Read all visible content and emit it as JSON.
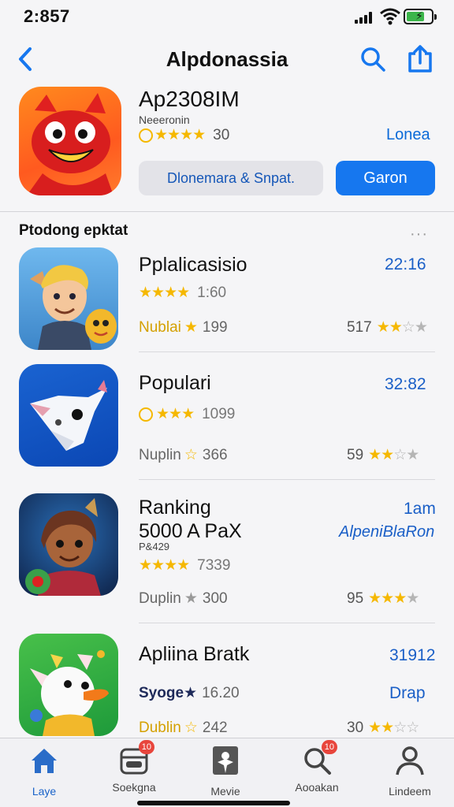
{
  "status": {
    "time": "2:857"
  },
  "nav": {
    "title": "Alpdonassia"
  },
  "featured": {
    "title": "Ap2308IM",
    "subtitle": "Neeeronin",
    "stars": "★★★★",
    "rating": "30",
    "link": "Lonea",
    "secondary_button": "Dlonemara & Snpat.",
    "primary_button": "Garon"
  },
  "section": {
    "title": "Ptodong epktat",
    "more": "···"
  },
  "apps": [
    {
      "name": "Pplalicasisio",
      "time": "22:16",
      "stars": "★★★★",
      "rating": "1:60",
      "meta_label": "Nublai",
      "meta_star": "★",
      "meta_value": "199",
      "side_value": "517",
      "side_stars_on": "★★",
      "side_stars_off": "☆★"
    },
    {
      "name": "Populari",
      "time": "32:82",
      "stars": "★★★",
      "rating": "1099",
      "meta_label": "Nuplin",
      "meta_star": "☆",
      "meta_value": "366",
      "side_value": "59",
      "side_stars_on": "★★",
      "side_stars_off": "☆★"
    },
    {
      "name": "Ranking",
      "extra": "5000 A PaX",
      "extra2": "P&429",
      "time": "1am",
      "link": "AlpeniBlaRon",
      "stars": "★★★★",
      "rating": "7339",
      "meta_label": "Duplin",
      "meta_star": "★",
      "meta_value": "300",
      "side_value": "95",
      "side_stars_on": "★★★",
      "side_stars_off": "★"
    },
    {
      "name": "Apliina Bratk",
      "time": "31912",
      "meta_top_label": "Syoge",
      "meta_top_star": "★",
      "meta_top_value": "16.20",
      "link": "Drap",
      "meta_label": "Dublin",
      "meta_star": "☆",
      "meta_value": "242",
      "side_value": "30",
      "side_stars_on": "★★",
      "side_stars_off": "☆☆"
    }
  ],
  "tabs": [
    {
      "label": "Laye",
      "active": true
    },
    {
      "label": "Soekgna",
      "badge": "10"
    },
    {
      "label": "Mevie"
    },
    {
      "label": "Aooakan",
      "badge": "10"
    },
    {
      "label": "Lindeem"
    }
  ],
  "colors": {
    "accent": "#1677ef",
    "star": "#f5b800",
    "link": "#1a5fc7",
    "badge": "#e8453c"
  }
}
